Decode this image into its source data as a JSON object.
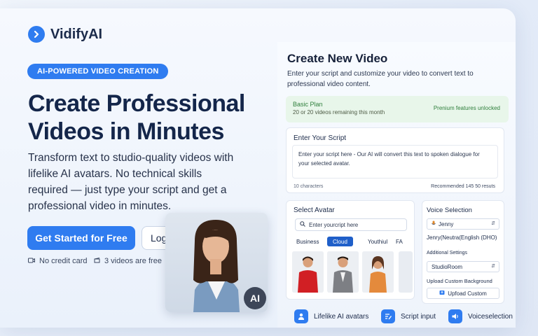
{
  "brand": {
    "name": "VidifyAI"
  },
  "hero": {
    "badge": "AI-POWERED VIDEO CREATION",
    "title": "Create Professional Videos in Minutes",
    "description": "Transform text to studio-quality videos with lifelike AI avatars. No technical skills required — just type your script and get a professional video in minutes.",
    "cta_label": "Get Started for Free",
    "login_label": "Log",
    "perks": [
      "No credit card",
      "3 videos are free"
    ],
    "ai_badge": "AI"
  },
  "panel": {
    "title": "Create New Video",
    "subtitle": "Enter your script and customize your video to convert text to professional video content.",
    "plan": {
      "name": "Basic Plan",
      "remaining": "20 or 20 videos remaining this month",
      "premium": "Prenium features unlocked"
    },
    "script": {
      "label": "Enter Your Script",
      "text": "Enter your script here - Our AI will convert this text to spoken dialogue for your selected avatar.",
      "count": "10 characters",
      "recommended": "Recommended 145 50 resuts"
    },
    "avatar": {
      "label": "Select Avatar",
      "search_placeholder": "Enter yourcript here",
      "tabs": [
        "Business",
        "Cloud",
        "Youthiul",
        "FA"
      ],
      "active_tab": "Cloud"
    },
    "voice": {
      "label": "Voice Selection",
      "selected": "Jenny",
      "description": "Jenry(Neutra(English (DHO)",
      "settings_label": "Additional Settings",
      "background_selected": "StudioRoom",
      "upload_label": "Upload Custom Background",
      "upload_button": "Upfoad Custom"
    },
    "features": [
      "Lifelike AI avatars",
      "Script input",
      "Voiceselection"
    ]
  },
  "colors": {
    "accent": "#2f7cf0",
    "heading": "#14264a",
    "premium": "#2f7f3c",
    "active_tab": "#1f5fc9"
  },
  "icons": [
    "play-chevron-icon",
    "camera-icon",
    "clapper-icon",
    "search-icon",
    "mic-icon",
    "chevron-updown-icon",
    "upload-icon",
    "person-icon",
    "text-icon",
    "speaker-icon"
  ]
}
